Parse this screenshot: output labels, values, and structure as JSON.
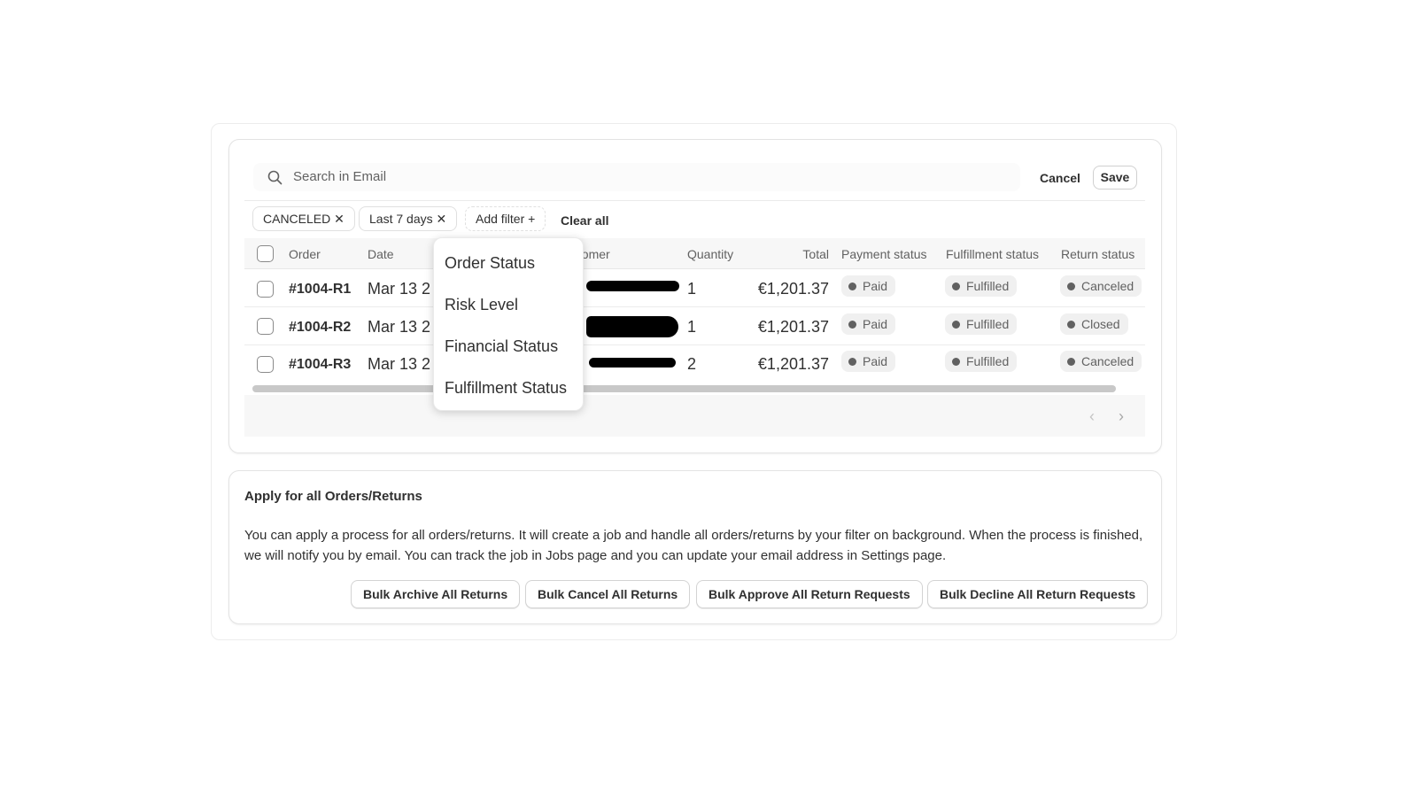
{
  "search": {
    "placeholder": "Search in Email",
    "cancel_label": "Cancel",
    "save_label": "Save"
  },
  "filters": {
    "chips": [
      {
        "label": "CANCELED"
      },
      {
        "label": "Last 7 days"
      }
    ],
    "add_filter_label": "Add filter +",
    "clear_all_label": "Clear all"
  },
  "table": {
    "columns": [
      "Order",
      "Date",
      "Customer",
      "Quantity",
      "Total",
      "Payment status",
      "Fulfillment status",
      "Return status"
    ],
    "rows": [
      {
        "order": "#1004-R1",
        "date": "Mar 13 2",
        "quantity": "1",
        "total": "€1,201.37",
        "payment": "Paid",
        "fulfillment": "Fulfilled",
        "return": "Canceled"
      },
      {
        "order": "#1004-R2",
        "date": "Mar 13 2",
        "quantity": "1",
        "total": "€1,201.37",
        "payment": "Paid",
        "fulfillment": "Fulfilled",
        "return": "Closed"
      },
      {
        "order": "#1004-R3",
        "date": "Mar 13 2",
        "quantity": "2",
        "total": "€1,201.37",
        "payment": "Paid",
        "fulfillment": "Fulfilled",
        "return": "Canceled"
      }
    ]
  },
  "dropdown": {
    "items": [
      "Order Status",
      "Risk Level",
      "Financial Status",
      "Fulfillment Status"
    ]
  },
  "bulk": {
    "title": "Apply for all Orders/Returns",
    "description": "You can apply a process for all orders/returns. It will create a job and handle all orders/returns by your filter on background. When the process is finished, we will notify you by email. You can track the job in Jobs page and you can update your email address in Settings page.",
    "buttons": [
      "Bulk Archive All Returns",
      "Bulk Cancel All Returns",
      "Bulk Approve All Return Requests",
      "Bulk Decline All Return Requests"
    ]
  },
  "icons": {
    "search": "search-icon",
    "close": "close-icon",
    "prev": "chevron-left-icon",
    "next": "chevron-right-icon"
  }
}
